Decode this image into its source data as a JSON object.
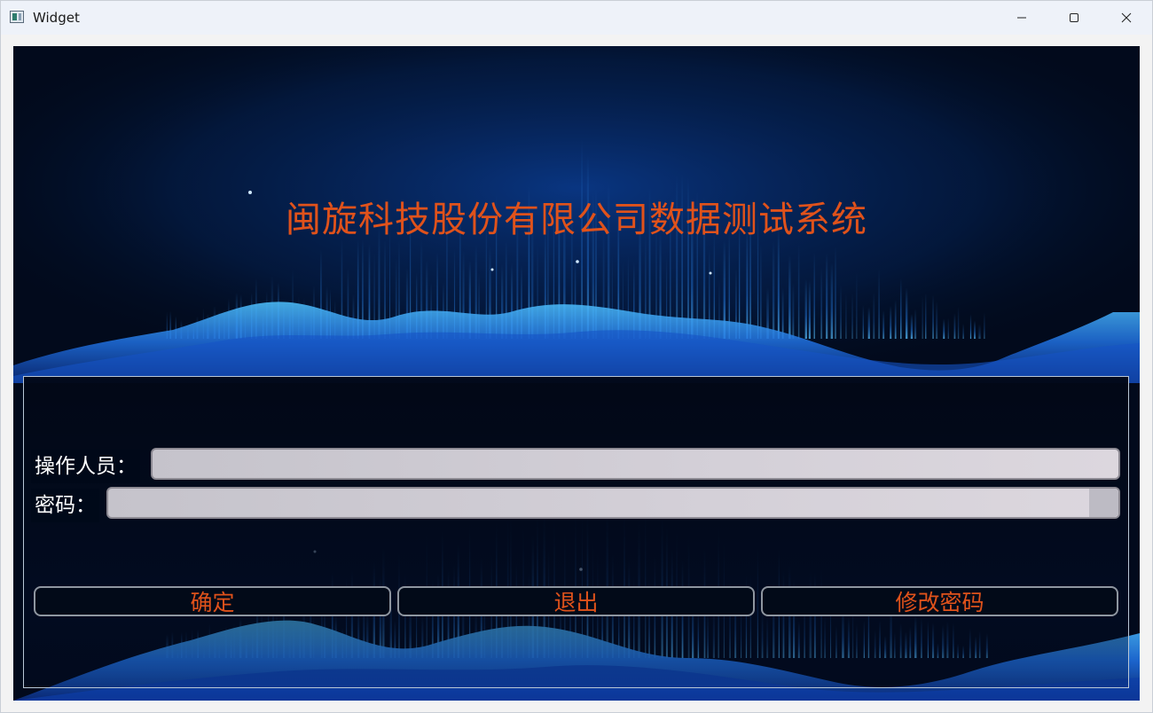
{
  "window": {
    "title": "Widget",
    "controls": [
      "minimize-icon",
      "maximize-icon",
      "close-icon"
    ]
  },
  "header": {
    "title": "闽旋科技股份有限公司数据测试系统",
    "title_color": "#e0521b"
  },
  "login": {
    "operator_label": "操作人员：",
    "operator_value": "",
    "password_label": "密码：",
    "password_value": ""
  },
  "buttons": {
    "confirm": "确定",
    "exit": "退出",
    "change_password": "修改密码"
  },
  "colors": {
    "background": "#020a1a",
    "accent": "#e0521b",
    "glow": "#1e8fff"
  }
}
